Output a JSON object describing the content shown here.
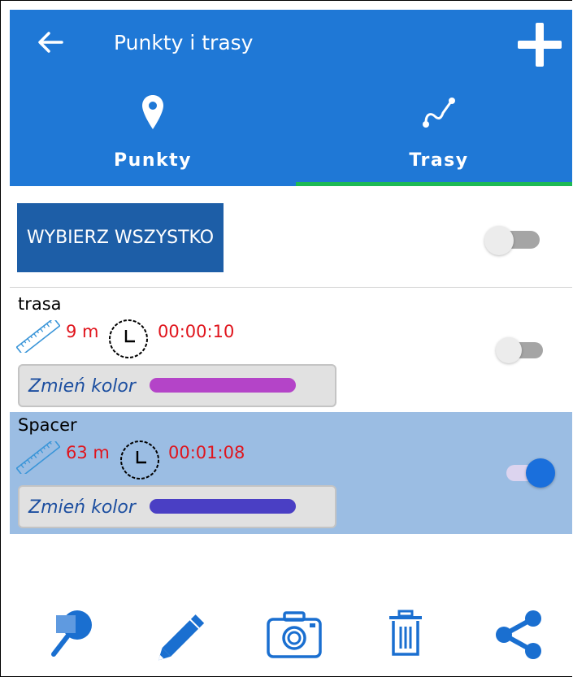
{
  "header": {
    "title": "Punkty i trasy",
    "back_icon": "arrow-left-icon",
    "add_icon": "plus-icon"
  },
  "tabs": [
    {
      "label": "Punkty",
      "icon": "map-pin-icon",
      "active": false
    },
    {
      "label": "Trasy",
      "icon": "route-icon",
      "active": true
    }
  ],
  "select_all": {
    "label": "WYBIERZ WSZYSTKO",
    "checked": false
  },
  "routes": [
    {
      "name": "trasa",
      "distance": "9 m",
      "duration": "00:00:10",
      "change_color_label": "Zmień kolor",
      "color": "#b444c8",
      "selected": false
    },
    {
      "name": "Spacer",
      "distance": "63 m",
      "duration": "00:01:08",
      "change_color_label": "Zmień kolor",
      "color": "#4a3fc4",
      "selected": true
    }
  ],
  "toolbar": [
    "zoom-to-icon",
    "edit-pencil-icon",
    "camera-icon",
    "trash-icon",
    "share-icon"
  ],
  "colors": {
    "app_bar": "#1f78d6",
    "tab_indicator": "#1db954",
    "select_all_button": "#1d5ea7",
    "selected_row": "#9bbde3",
    "value_text": "#e0141c",
    "switch_on": "#1a6fdc",
    "icon_blue": "#1a6fd0"
  }
}
